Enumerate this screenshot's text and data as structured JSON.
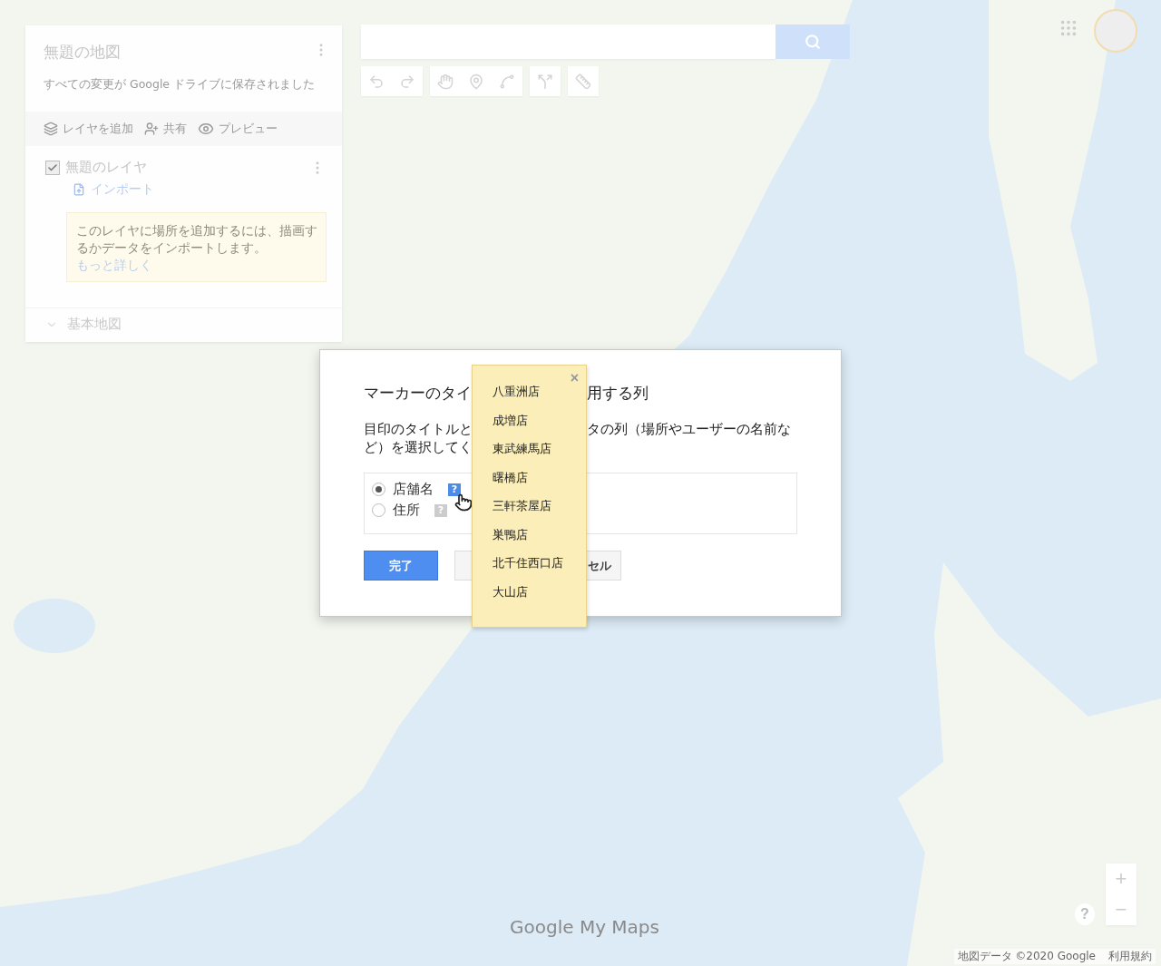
{
  "panel": {
    "title": "無題の地図",
    "status": "すべての変更が Google ドライブに保存されました",
    "actions": [
      {
        "kind": "layers",
        "label": "レイヤを追加"
      },
      {
        "kind": "share",
        "label": "共有"
      },
      {
        "kind": "preview",
        "label": "プレビュー"
      }
    ],
    "layer": {
      "name": "無題のレイヤ",
      "checked": true,
      "import": "インポート",
      "hint": "このレイヤに場所を追加するには、描画するかデータをインポートします。",
      "hint_link": "もっと詳しく"
    },
    "base_map": {
      "label": "基本地図",
      "expanded": false
    }
  },
  "dialog": {
    "title_parts": [
      "マーカーのタイ",
      "用する列"
    ],
    "description_parts": [
      "目印のタイトルと",
      "タの列（場所やユーザーの名前な",
      "ど）を選択してく"
    ],
    "options": [
      {
        "label": "店舗名",
        "selected": true,
        "help_hovered": true,
        "help_mark": "?"
      },
      {
        "label": "住所",
        "selected": false,
        "help_hovered": false,
        "help_mark": "?"
      }
    ],
    "done": "完了",
    "cancel": "セル"
  },
  "tooltip": {
    "close": "×",
    "items": [
      "八重洲店",
      "成増店",
      "東武練馬店",
      "曙橋店",
      "三軒茶屋店",
      "巣鴨店",
      "北千住西口店",
      "大山店"
    ]
  },
  "zoom": {
    "in": "+",
    "out": "−"
  },
  "help": "?",
  "footer": {
    "logo": "Google My Maps",
    "attribution": "地図データ ©2020 Google",
    "terms": "利用規約"
  }
}
